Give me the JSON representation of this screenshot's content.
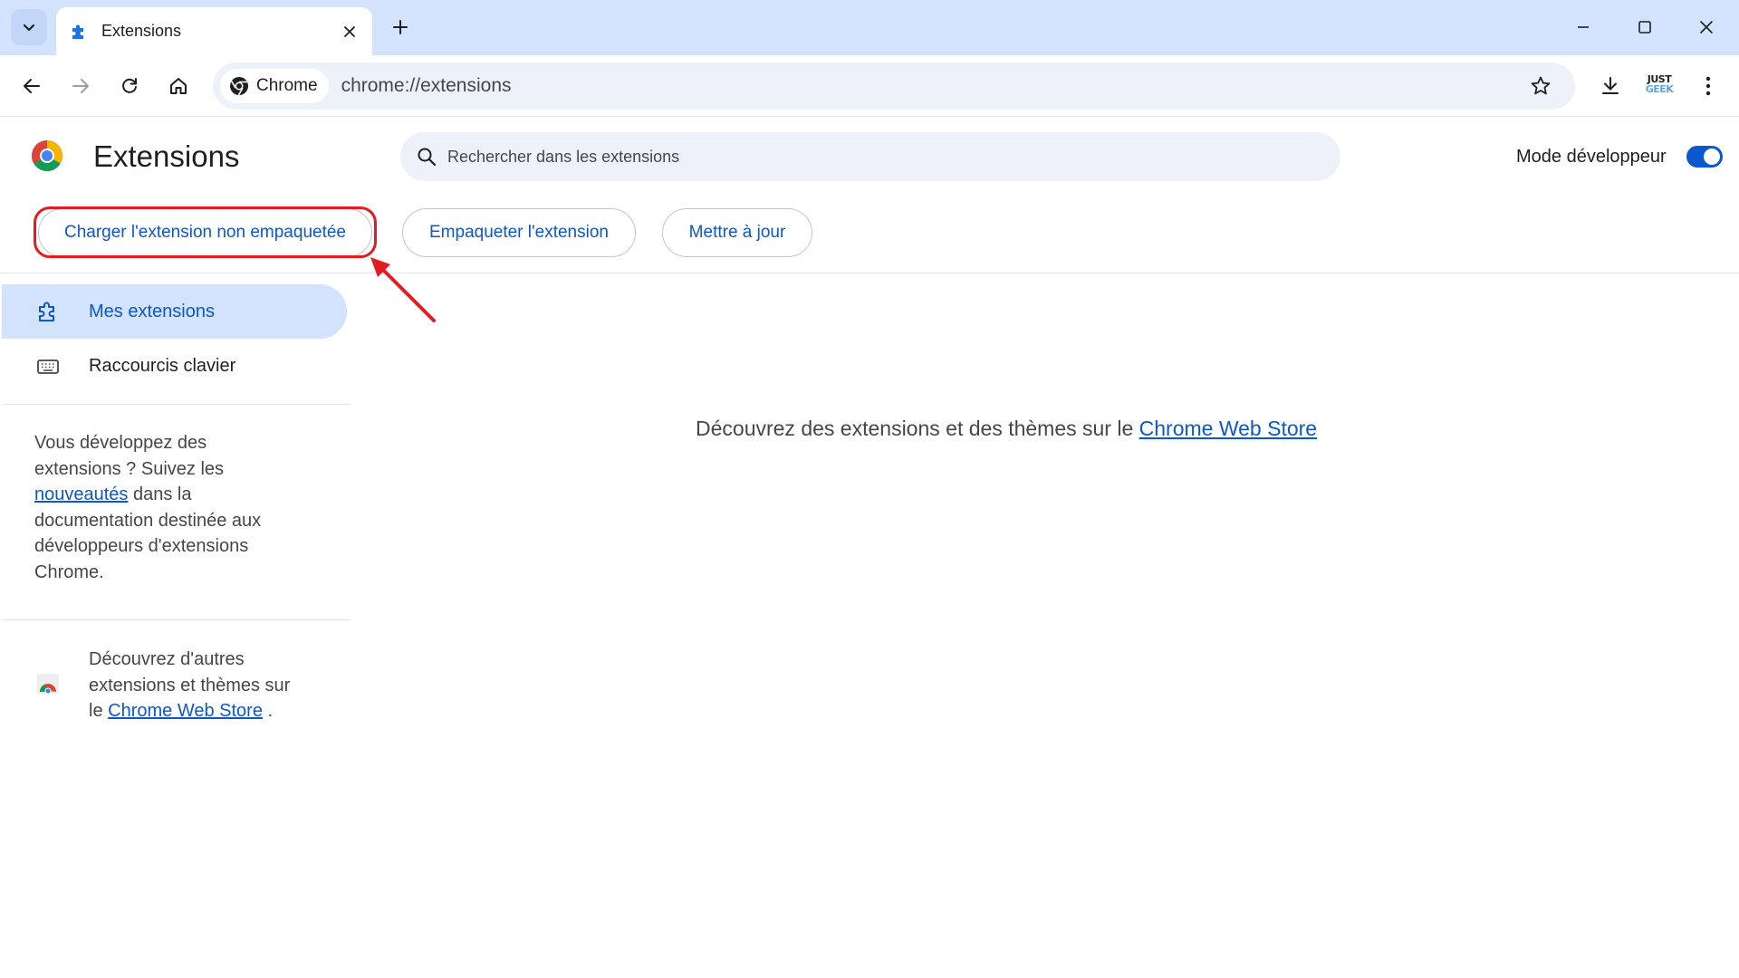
{
  "tab": {
    "title": "Extensions"
  },
  "toolbar": {
    "chip_label": "Chrome",
    "url": "chrome://extensions",
    "ext_badge_top": "JUST",
    "ext_badge_bottom": "GEEK"
  },
  "header": {
    "title": "Extensions",
    "search_placeholder": "Rechercher dans les extensions",
    "dev_mode_label": "Mode développeur",
    "dev_mode_enabled": true,
    "buttons": {
      "load_unpacked": "Charger l'extension non empaquetée",
      "pack": "Empaqueter l'extension",
      "update": "Mettre à jour"
    }
  },
  "sidebar": {
    "items": [
      {
        "label": "Mes extensions",
        "active": true
      },
      {
        "label": "Raccourcis clavier",
        "active": false
      }
    ],
    "dev_note": {
      "line1": "Vous développez des",
      "line2": "extensions ? Suivez les",
      "link": "nouveautés",
      "line3_after": " dans la",
      "line4": "documentation destinée aux",
      "line5": "développeurs d'extensions",
      "line6": "Chrome."
    },
    "store_note": {
      "line1": "Découvrez d'autres",
      "line2": "extensions et thèmes sur",
      "line3_before": "le ",
      "link": "Chrome Web Store",
      "line3_after": " ."
    }
  },
  "main": {
    "message": "Découvrez des extensions et des thèmes sur le ",
    "link": "Chrome Web Store"
  },
  "colors": {
    "accent": "#0b57d0",
    "highlight": "#e31b23",
    "tabstrip": "#d3e3fd"
  }
}
